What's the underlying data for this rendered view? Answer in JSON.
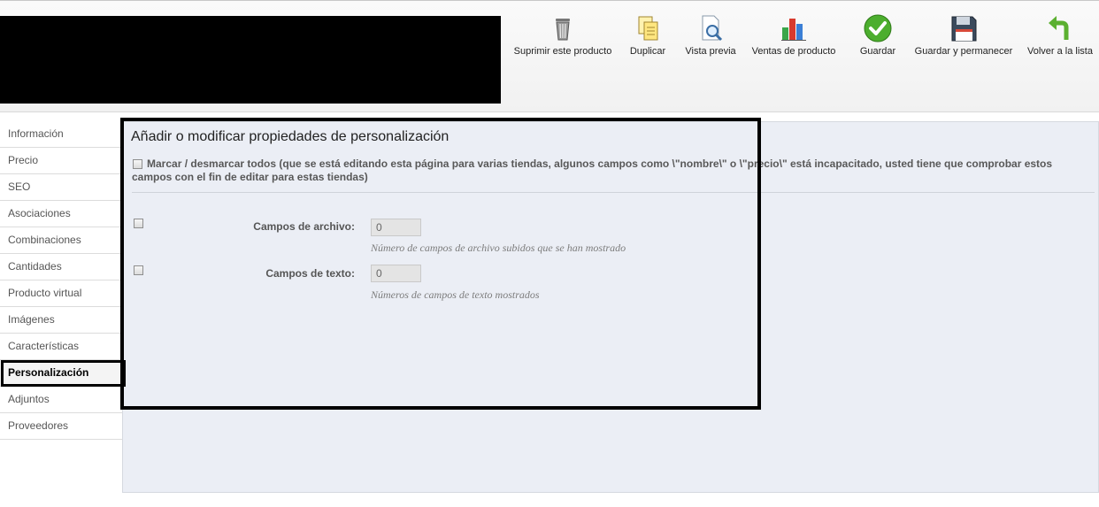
{
  "toolbar": {
    "items": [
      {
        "label": "Suprimir este producto",
        "icon": "trash-icon"
      },
      {
        "label": "Duplicar",
        "icon": "duplicate-icon"
      },
      {
        "label": "Vista previa",
        "icon": "preview-icon"
      },
      {
        "label": "Ventas de producto",
        "icon": "sales-chart-icon"
      },
      {
        "label": "Guardar",
        "icon": "save-check-icon"
      },
      {
        "label": "Guardar y permanecer",
        "icon": "floppy-disk-icon"
      },
      {
        "label": "Volver a la lista",
        "icon": "back-arrow-icon"
      }
    ]
  },
  "sidebar": {
    "items": [
      {
        "label": "Información"
      },
      {
        "label": "Precio"
      },
      {
        "label": "SEO"
      },
      {
        "label": "Asociaciones"
      },
      {
        "label": "Combinaciones"
      },
      {
        "label": "Cantidades"
      },
      {
        "label": "Producto virtual"
      },
      {
        "label": "Imágenes"
      },
      {
        "label": "Características"
      },
      {
        "label": "Personalización"
      },
      {
        "label": "Adjuntos"
      },
      {
        "label": "Proveedores"
      }
    ],
    "active": "Personalización"
  },
  "main": {
    "title": "Añadir o modificar propiedades de personalización",
    "mass_check_label": "Marcar / desmarcar todos (que se está editando esta página para varias tiendas, algunos campos como \\\"nombre\\\" o \\\"precio\\\" está incapacitado, usted tiene que comprobar estos campos con el fin de editar para estas tiendas)",
    "fields": [
      {
        "label": "Campos de archivo:",
        "value": "0",
        "hint": "Número de campos de archivo subidos que se han mostrado"
      },
      {
        "label": "Campos de texto:",
        "value": "0",
        "hint": "Números de campos de texto mostrados"
      }
    ]
  },
  "colors": {
    "panel_bg": "#ebeef5",
    "highlight": "#000000"
  }
}
